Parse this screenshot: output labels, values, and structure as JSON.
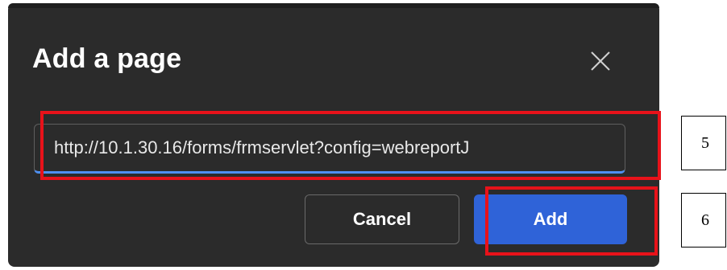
{
  "dialog": {
    "title": "Add a page",
    "close_icon": "close-icon",
    "url_value": "http://10.1.30.16/forms/frmservlet?config=webreportJ",
    "cancel_label": "Cancel",
    "add_label": "Add"
  },
  "annotations": {
    "step_url": "5",
    "step_add": "6",
    "highlight_color": "#e8121a"
  },
  "colors": {
    "dialog_bg": "#2b2b2b",
    "accent": "#2f63d8",
    "focus_underline": "#4f8ff0"
  }
}
